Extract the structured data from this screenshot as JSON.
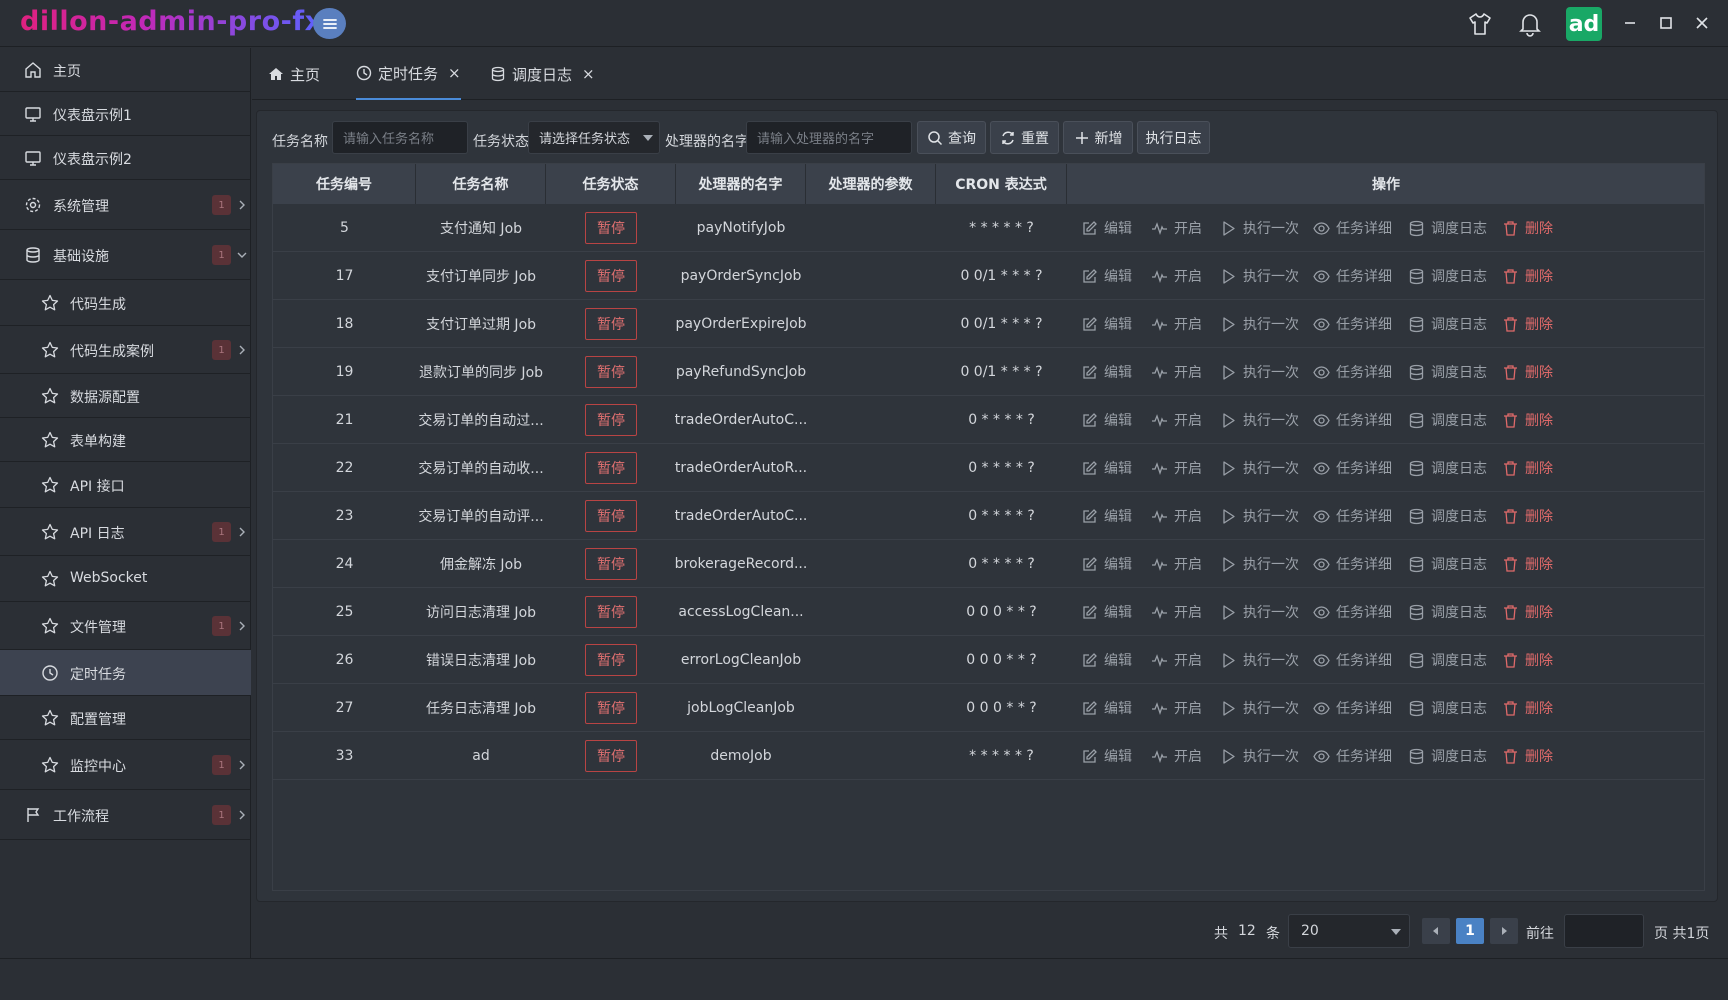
{
  "app": {
    "title": "dillon-admin-pro-fx",
    "avatar_text": "ad"
  },
  "sidebar": {
    "items": [
      {
        "label": "主页",
        "icon": "home-icon",
        "level": 1
      },
      {
        "label": "仪表盘示例1",
        "icon": "monitor-icon",
        "level": 1
      },
      {
        "label": "仪表盘示例2",
        "icon": "monitor-icon",
        "level": 1
      },
      {
        "label": "系统管理",
        "icon": "gear-icon",
        "level": 1,
        "badge": "1",
        "chevron": "right"
      },
      {
        "label": "基础设施",
        "icon": "database-icon",
        "level": 1,
        "badge": "1",
        "chevron": "down"
      },
      {
        "label": "代码生成",
        "icon": "star-icon",
        "level": 2
      },
      {
        "label": "代码生成案例",
        "icon": "star-icon",
        "level": 2,
        "badge": "1",
        "chevron": "right"
      },
      {
        "label": "数据源配置",
        "icon": "star-icon",
        "level": 2
      },
      {
        "label": "表单构建",
        "icon": "star-icon",
        "level": 2
      },
      {
        "label": "API 接口",
        "icon": "star-icon",
        "level": 2
      },
      {
        "label": "API 日志",
        "icon": "star-icon",
        "level": 2,
        "badge": "1",
        "chevron": "right"
      },
      {
        "label": "WebSocket",
        "icon": "star-icon",
        "level": 2
      },
      {
        "label": "文件管理",
        "icon": "star-icon",
        "level": 2,
        "badge": "1",
        "chevron": "right"
      },
      {
        "label": "定时任务",
        "icon": "clock-icon",
        "level": 2,
        "active": true
      },
      {
        "label": "配置管理",
        "icon": "star-icon",
        "level": 2
      },
      {
        "label": "监控中心",
        "icon": "star-icon",
        "level": 2,
        "badge": "1",
        "chevron": "right"
      },
      {
        "label": "工作流程",
        "icon": "flag-icon",
        "level": 1,
        "badge": "1",
        "chevron": "right"
      }
    ]
  },
  "tabs": [
    {
      "label": "主页",
      "icon": "home-icon",
      "closable": false
    },
    {
      "label": "定时任务",
      "icon": "clock-icon",
      "closable": true,
      "active": true,
      "close_label": "×"
    },
    {
      "label": "调度日志",
      "icon": "database-icon",
      "closable": true,
      "close_label": "×"
    }
  ],
  "search": {
    "name_label": "任务名称",
    "name_placeholder": "请输入任务名称",
    "status_label": "任务状态",
    "status_value": "请选择任务状态",
    "handler_label": "处理器的名字",
    "handler_placeholder": "请输入处理器的名字",
    "query_button": "查询",
    "reset_button": "重置",
    "add_button": "新增",
    "log_button": "执行日志"
  },
  "table": {
    "columns": [
      "任务编号",
      "任务名称",
      "任务状态",
      "处理器的名字",
      "处理器的参数",
      "CRON 表达式",
      "操作"
    ],
    "actions": {
      "edit": "编辑",
      "start": "开启",
      "run_once": "执行一次",
      "detail": "任务详细",
      "log": "调度日志",
      "delete": "删除"
    },
    "rows": [
      {
        "id": "5",
        "name": "支付通知 Job",
        "status": "暂停",
        "handler": "payNotifyJob",
        "param": "",
        "cron": "* * * * * ?"
      },
      {
        "id": "17",
        "name": "支付订单同步 Job",
        "status": "暂停",
        "handler": "payOrderSyncJob",
        "param": "",
        "cron": "0 0/1 * * * ?"
      },
      {
        "id": "18",
        "name": "支付订单过期 Job",
        "status": "暂停",
        "handler": "payOrderExpireJob",
        "param": "",
        "cron": "0 0/1 * * * ?"
      },
      {
        "id": "19",
        "name": "退款订单的同步 Job",
        "status": "暂停",
        "handler": "payRefundSyncJob",
        "param": "",
        "cron": "0 0/1 * * * ?"
      },
      {
        "id": "21",
        "name": "交易订单的自动过...",
        "status": "暂停",
        "handler": "tradeOrderAutoC...",
        "param": "",
        "cron": "0 * * * * ?"
      },
      {
        "id": "22",
        "name": "交易订单的自动收...",
        "status": "暂停",
        "handler": "tradeOrderAutoR...",
        "param": "",
        "cron": "0 * * * * ?"
      },
      {
        "id": "23",
        "name": "交易订单的自动评...",
        "status": "暂停",
        "handler": "tradeOrderAutoC...",
        "param": "",
        "cron": "0 * * * * ?"
      },
      {
        "id": "24",
        "name": "佣金解冻 Job",
        "status": "暂停",
        "handler": "brokerageRecord...",
        "param": "",
        "cron": "0 * * * * ?"
      },
      {
        "id": "25",
        "name": "访问日志清理 Job",
        "status": "暂停",
        "handler": "accessLogClean...",
        "param": "",
        "cron": "0 0 0 * * ?"
      },
      {
        "id": "26",
        "name": "错误日志清理 Job",
        "status": "暂停",
        "handler": "errorLogCleanJob",
        "param": "",
        "cron": "0 0 0 * * ?"
      },
      {
        "id": "27",
        "name": "任务日志清理 Job",
        "status": "暂停",
        "handler": "jobLogCleanJob",
        "param": "",
        "cron": "0 0 0 * * ?"
      },
      {
        "id": "33",
        "name": "ad",
        "status": "暂停",
        "handler": "demoJob",
        "param": "",
        "cron": "* * * * * ?"
      }
    ]
  },
  "pagination": {
    "total_prefix": "共",
    "total": "12",
    "total_suffix": "条",
    "page_size": "20",
    "current_page": "1",
    "goto_label": "前往",
    "pages_suffix": "页 共1页"
  },
  "colors": {
    "accent": "#4a82c4",
    "danger": "#e06a6a",
    "avatar_bg": "#19a866"
  }
}
